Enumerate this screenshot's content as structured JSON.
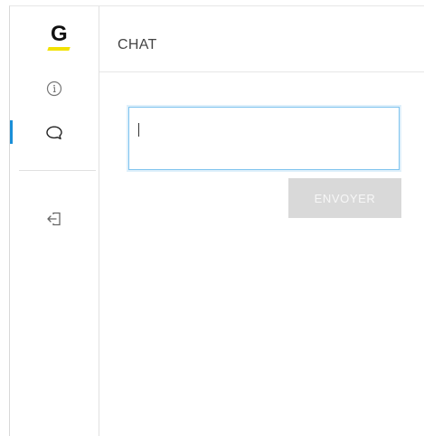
{
  "brand": {
    "logo_letter": "G",
    "accent_color": "#f2e100"
  },
  "sidebar": {
    "active_indicator_color": "#1a8fd8",
    "items": [
      {
        "icon": "info-icon",
        "active": false
      },
      {
        "icon": "chat-bubble-icon",
        "active": true
      },
      {
        "icon": "logout-icon",
        "active": false
      }
    ]
  },
  "header": {
    "title": "CHAT"
  },
  "chat": {
    "input_value": "",
    "send_label": "ENVOYER",
    "send_enabled": false
  }
}
